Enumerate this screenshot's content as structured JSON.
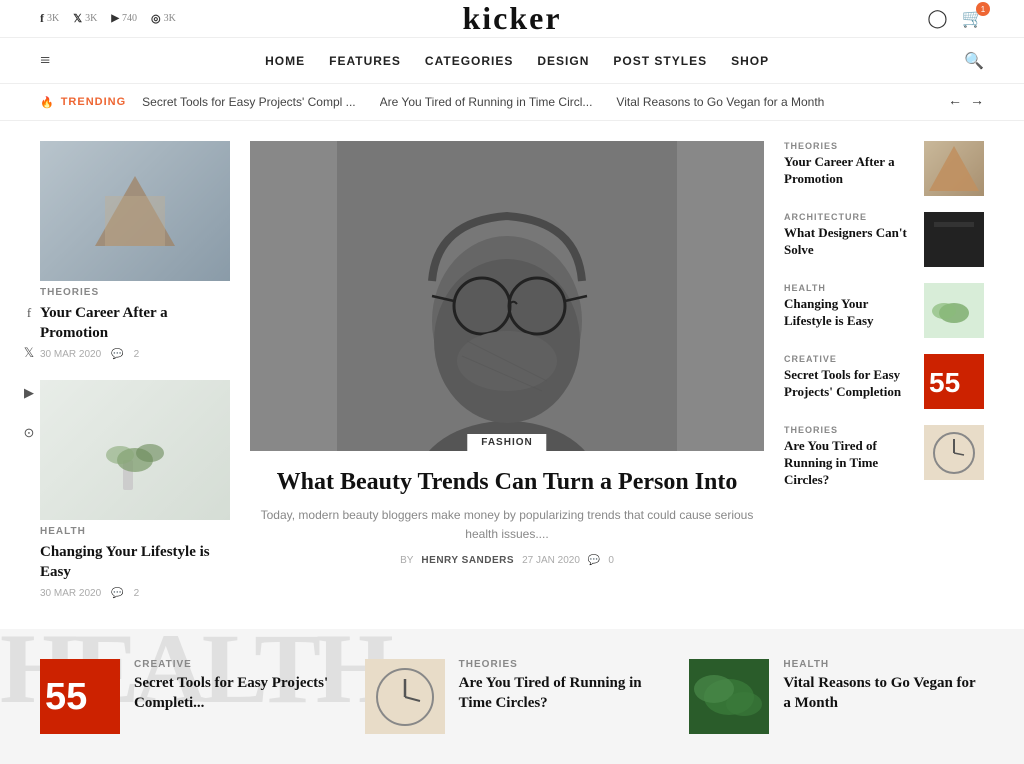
{
  "logo": "kicker",
  "topbar": {
    "socials": [
      {
        "icon": "f",
        "label": "3K",
        "platform": "facebook"
      },
      {
        "icon": "𝕏",
        "label": "3K",
        "platform": "twitter"
      },
      {
        "icon": "▶",
        "label": "740",
        "platform": "youtube"
      },
      {
        "icon": "⊙",
        "label": "3K",
        "platform": "instagram"
      }
    ],
    "cart_count": "1"
  },
  "nav": {
    "hamburger": "≡",
    "links": [
      "HOME",
      "FEATURES",
      "CATEGORIES",
      "DESIGN",
      "POST STYLES",
      "SHOP"
    ]
  },
  "trending": {
    "label": "TRENDING",
    "items": [
      "Secret Tools for Easy Projects' Compl ...",
      "Are You Tired of Running in Time Circl...",
      "Vital Reasons to Go Vegan for a Month"
    ]
  },
  "left_articles": [
    {
      "category": "THEORIES",
      "title": "Your Career After a Promotion",
      "date": "30 MAR 2020",
      "comments": "2",
      "thumb_type": "triangle"
    },
    {
      "category": "HEALTH",
      "title": "Changing Your Lifestyle is Easy",
      "date": "30 MAR 2020",
      "comments": "2",
      "thumb_type": "plant"
    }
  ],
  "featured": {
    "category": "FASHION",
    "title": "What Beauty Trends Can Turn a Person Into",
    "excerpt": "Today, modern beauty bloggers make money by popularizing trends that could cause serious health issues....",
    "author_by": "BY",
    "author": "HENRY SANDERS",
    "date": "27 JAN 2020",
    "comments": "0"
  },
  "right_articles": [
    {
      "category": "THEORIES",
      "title": "Your Career After a Promotion",
      "thumb_type": "wood"
    },
    {
      "category": "ARCHITECTURE",
      "title": "What Designers Can't Solve",
      "thumb_type": "dark"
    },
    {
      "category": "HEALTH",
      "title": "Changing Your Lifestyle is Easy",
      "thumb_type": "plant2"
    },
    {
      "category": "CREATIVE",
      "title": "Secret Tools for Easy Projects' Completion",
      "thumb_type": "laptop"
    },
    {
      "category": "THEORIES",
      "title": "Are You Tired of Running in Time Circles?",
      "thumb_type": "clock"
    }
  ],
  "bottom_articles": [
    {
      "category": "CREATIVE",
      "title": "Secret Tools for Easy Projects' Completi...",
      "thumb_type": "laptop"
    },
    {
      "category": "THEORIES",
      "title": "Are You Tired of Running in Time Circles?",
      "thumb_type": "clock"
    },
    {
      "category": "HEALTH",
      "title": "Vital Reasons to Go Vegan for a Month",
      "thumb_type": "green"
    }
  ],
  "bottom_watermark": "HEALTH"
}
